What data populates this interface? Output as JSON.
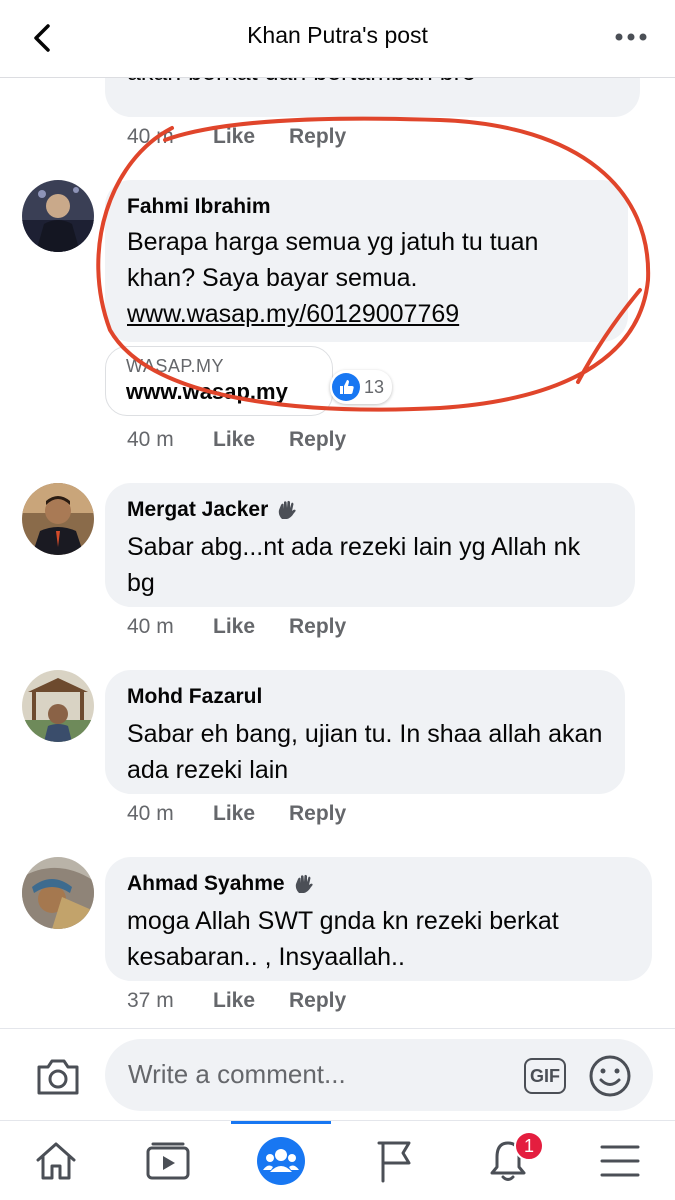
{
  "header": {
    "title": "Khan Putra's post",
    "back_icon": "chevron-left-icon",
    "more_icon": "more-dots-icon"
  },
  "comments": [
    {
      "name": "",
      "text": "akan berkat dan bertambah bro",
      "time": "40 m",
      "like": "Like",
      "reply": "Reply"
    },
    {
      "name": "Fahmi Ibrahim",
      "text": "Berapa harga semua yg jatuh tu tuan khan? Saya bayar semua.",
      "link": "www.wasap.my/60129007769",
      "link_card": {
        "domain": "WASAP.MY",
        "title": "www.wasap.my"
      },
      "reactions": "13",
      "time": "40 m",
      "like": "Like",
      "reply": "Reply"
    },
    {
      "name": "Mergat Jacker",
      "text": "Sabar abg...nt ada rezeki lain yg Allah nk bg",
      "time": "40 m",
      "like": "Like",
      "reply": "Reply"
    },
    {
      "name": "Mohd Fazarul",
      "text": "Sabar eh bang, ujian tu. In shaa allah akan ada rezeki lain",
      "time": "40 m",
      "like": "Like",
      "reply": "Reply"
    },
    {
      "name": "Ahmad Syahme",
      "text": "moga Allah SWT gnda kn rezeki berkat kesabaran.. , Insyaallah..",
      "time": "37 m",
      "like": "Like",
      "reply": "Reply"
    }
  ],
  "composer": {
    "placeholder": "Write a comment...",
    "gif_label": "GIF"
  },
  "tabbar": {
    "notifications_badge": "1",
    "active_tab": "groups"
  },
  "colors": {
    "accent": "#1877f2",
    "bubble": "#f0f2f5",
    "meta_text": "#65676b",
    "annotation": "#e0452b",
    "badge": "#e41e3f"
  }
}
